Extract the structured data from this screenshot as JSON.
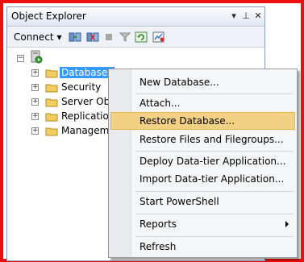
{
  "window": {
    "title": "Object Explorer"
  },
  "toolbar": {
    "connect_label": "Connect",
    "connect_caret": "▾"
  },
  "title_buttons": {
    "pin": "▾",
    "autohide": "⊥",
    "close": "✕"
  },
  "tree": {
    "root_expander": "−",
    "nodes": [
      {
        "label": "Databases",
        "expander": "+"
      },
      {
        "label": "Security",
        "expander": "+"
      },
      {
        "label": "Server Obje",
        "expander": "+"
      },
      {
        "label": "Replication",
        "expander": "+"
      },
      {
        "label": "Manageme",
        "expander": "+"
      }
    ]
  },
  "context_menu": {
    "items": [
      {
        "label": "New Database..."
      },
      {
        "label": "Attach..."
      },
      {
        "label": "Restore Database..."
      },
      {
        "label": "Restore Files and Filegroups..."
      },
      {
        "label": "Deploy Data-tier Application..."
      },
      {
        "label": "Import Data-tier Application..."
      },
      {
        "label": "Start PowerShell"
      },
      {
        "label": "Reports"
      },
      {
        "label": "Refresh"
      }
    ],
    "highlighted_item": "Restore Database...",
    "submenu_item": "Reports"
  },
  "colors": {
    "frame_border": "#ee0e0e",
    "selection": "#3399ff",
    "menu_highlight": "#f3d184"
  }
}
